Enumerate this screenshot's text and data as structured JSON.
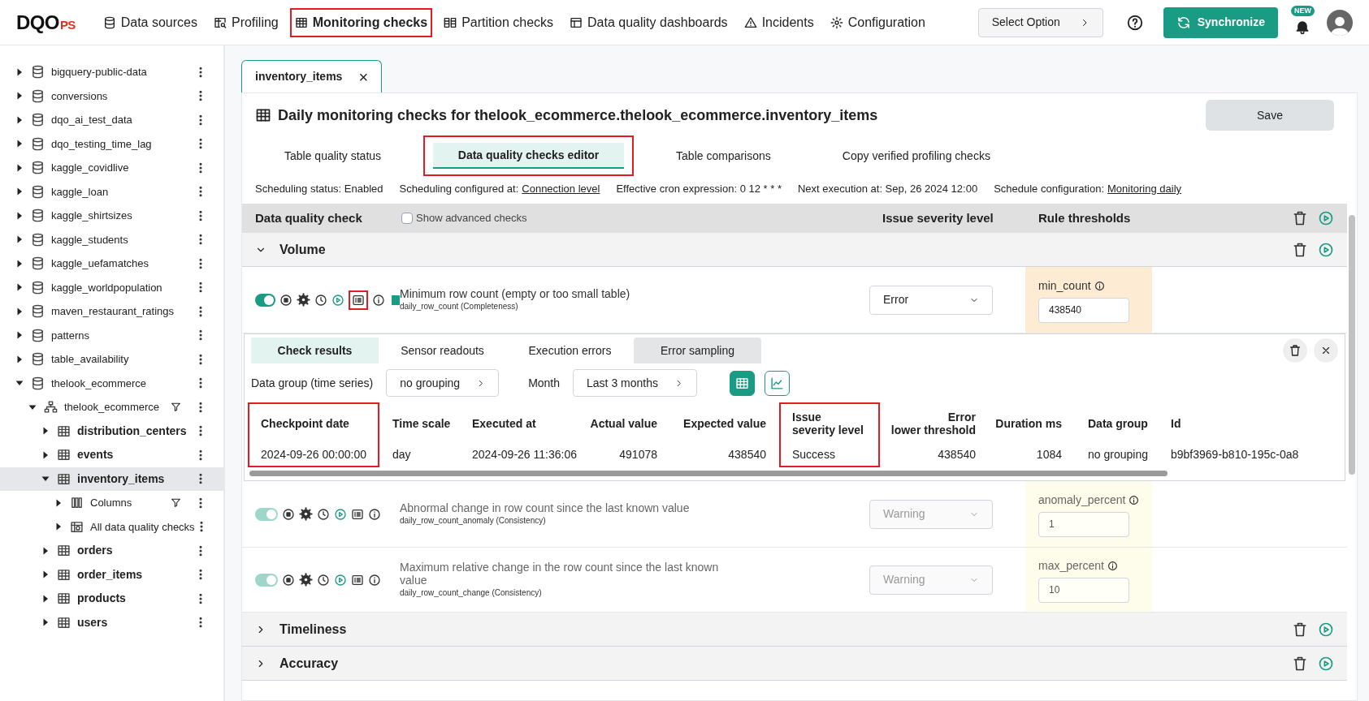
{
  "header": {
    "logo": {
      "main": "DQO",
      "suffix": "PS"
    },
    "nav": [
      {
        "kind": "database",
        "label": "Data sources",
        "selected": false,
        "highlighted": false
      },
      {
        "kind": "profiling",
        "label": "Profiling",
        "selected": false,
        "highlighted": false
      },
      {
        "kind": "table",
        "label": "Monitoring checks",
        "selected": true,
        "highlighted": true
      },
      {
        "kind": "partition",
        "label": "Partition checks",
        "selected": false,
        "highlighted": false
      },
      {
        "kind": "dashboard",
        "label": "Data quality dashboards",
        "selected": false,
        "highlighted": false
      },
      {
        "kind": "warning",
        "label": "Incidents",
        "selected": false,
        "highlighted": false
      },
      {
        "kind": "gear",
        "label": "Configuration",
        "selected": false,
        "highlighted": false
      }
    ],
    "select_option": "Select Option",
    "sync_button": "Synchronize",
    "new_badge": "NEW"
  },
  "sidebar": {
    "tree": [
      {
        "kind": "database",
        "label": "bigquery-public-data",
        "expanded": false,
        "selected": false
      },
      {
        "kind": "database",
        "label": "conversions",
        "expanded": false,
        "selected": false
      },
      {
        "kind": "database",
        "label": "dqo_ai_test_data",
        "expanded": false,
        "selected": false
      },
      {
        "kind": "database",
        "label": "dqo_testing_time_lag",
        "expanded": false,
        "selected": false
      },
      {
        "kind": "database",
        "label": "kaggle_covidlive",
        "expanded": false,
        "selected": false
      },
      {
        "kind": "database",
        "label": "kaggle_loan",
        "expanded": false,
        "selected": false
      },
      {
        "kind": "database",
        "label": "kaggle_shirtsizes",
        "expanded": false,
        "selected": false
      },
      {
        "kind": "database",
        "label": "kaggle_students",
        "expanded": false,
        "selected": false
      },
      {
        "kind": "database",
        "label": "kaggle_uefamatches",
        "expanded": false,
        "selected": false
      },
      {
        "kind": "database",
        "label": "kaggle_worldpopulation",
        "expanded": false,
        "selected": false
      },
      {
        "kind": "database",
        "label": "maven_restaurant_ratings",
        "expanded": false,
        "selected": false
      },
      {
        "kind": "database",
        "label": "patterns",
        "expanded": false,
        "selected": false
      },
      {
        "kind": "database",
        "label": "table_availability",
        "expanded": false,
        "selected": false
      },
      {
        "kind": "database",
        "label": "thelook_ecommerce",
        "expanded": true,
        "selected": false,
        "children": [
          {
            "kind": "schema",
            "label": "thelook_ecommerce",
            "expanded": true,
            "selected": false,
            "filter": true,
            "children": [
              {
                "kind": "table",
                "label": "distribution_centers",
                "expanded": false,
                "selected": false
              },
              {
                "kind": "table",
                "label": "events",
                "expanded": false,
                "selected": false
              },
              {
                "kind": "table",
                "label": "inventory_items",
                "expanded": true,
                "selected": true,
                "children": [
                  {
                    "kind": "columns",
                    "label": "Columns",
                    "expanded": false,
                    "selected": false,
                    "filter": true
                  },
                  {
                    "kind": "checks",
                    "label": "All data quality checks",
                    "expanded": false,
                    "selected": false
                  }
                ]
              },
              {
                "kind": "table",
                "label": "orders",
                "expanded": false,
                "selected": false
              },
              {
                "kind": "table",
                "label": "order_items",
                "expanded": false,
                "selected": false
              },
              {
                "kind": "table",
                "label": "products",
                "expanded": false,
                "selected": false
              },
              {
                "kind": "table",
                "label": "users",
                "expanded": false,
                "selected": false
              }
            ]
          }
        ]
      }
    ]
  },
  "editor_tab": {
    "label": "inventory_items",
    "close": "×"
  },
  "panel": {
    "title": "Daily monitoring checks for thelook_ecommerce.thelook_ecommerce.inventory_items",
    "save_button": "Save",
    "tabs": [
      {
        "label": "Table quality status",
        "selected": false,
        "highlighted": false
      },
      {
        "label": "Data quality checks editor",
        "selected": true,
        "highlighted": true
      },
      {
        "label": "Table comparisons",
        "selected": false,
        "highlighted": false
      },
      {
        "label": "Copy verified profiling checks",
        "selected": false,
        "highlighted": false
      }
    ],
    "schedule": [
      {
        "label": "Scheduling status: Enabled"
      },
      {
        "label": "Scheduling configured at:",
        "link": "Connection level"
      },
      {
        "label": "Effective cron expression: 0 12 * * *"
      },
      {
        "label": "Next execution at: Sep, 26 2024 12:00"
      },
      {
        "label": "Schedule configuration:",
        "link": "Monitoring daily"
      }
    ],
    "columns": {
      "check": "Data quality check",
      "advanced": "Show advanced checks",
      "advanced_checked": false,
      "severity": "Issue severity level",
      "thresholds": "Rule thresholds"
    },
    "categories": [
      {
        "name": "Volume",
        "expanded": true,
        "checks": [
          {
            "toggle_on": true,
            "configured": true,
            "results_open": true,
            "highlighted_results_icon": true,
            "title": "Minimum row count (empty or too small table)",
            "subtitle": "daily_row_count (Completeness)",
            "severity": "Error",
            "param": "min_count",
            "value": "438540"
          },
          {
            "toggle_on": true,
            "configured": false,
            "results_open": false,
            "highlighted_results_icon": false,
            "title": "Abnormal change in row count since the last known value",
            "subtitle": "daily_row_count_anomaly (Consistency)",
            "severity": "Warning",
            "param": "anomaly_percent",
            "value": "1"
          },
          {
            "toggle_on": true,
            "configured": false,
            "results_open": false,
            "highlighted_results_icon": false,
            "title": "Maximum relative change in the row count since the last known value",
            "subtitle": "daily_row_count_change (Consistency)",
            "severity": "Warning",
            "param": "max_percent",
            "value": "10"
          }
        ]
      },
      {
        "name": "Timeliness",
        "expanded": false
      },
      {
        "name": "Accuracy",
        "expanded": false
      }
    ]
  },
  "results": {
    "tabs": [
      {
        "label": "Check results",
        "selected": true,
        "hovered": false
      },
      {
        "label": "Sensor readouts",
        "selected": false,
        "hovered": false
      },
      {
        "label": "Execution errors",
        "selected": false,
        "hovered": false
      },
      {
        "label": "Error sampling",
        "selected": false,
        "hovered": true
      }
    ],
    "data_group_label": "Data group (time series)",
    "data_group": "no grouping",
    "month_label": "Month",
    "month": "Last 3 months",
    "views": [
      {
        "kind": "table",
        "selected": true
      },
      {
        "kind": "chart",
        "selected": false
      }
    ],
    "columns": [
      {
        "header": "Checkpoint date",
        "highlighted": true
      },
      {
        "header": "Time scale",
        "highlighted": false
      },
      {
        "header": "Executed at",
        "highlighted": false
      },
      {
        "header": "Actual value",
        "highlighted": false
      },
      {
        "header": "Expected value",
        "highlighted": false
      },
      {
        "header": "Issue\nseverity level",
        "highlighted": true
      },
      {
        "header": "Error\nlower threshold",
        "highlighted": false
      },
      {
        "header": "Duration ms",
        "highlighted": false
      },
      {
        "header": "Data group",
        "highlighted": false
      },
      {
        "header": "Id",
        "highlighted": false
      }
    ],
    "rows": [
      [
        "2024-09-26 00:00:00",
        "day",
        "2024-09-26 11:36:06",
        "491078",
        "438540",
        "Success",
        "438540",
        "1084",
        "no grouping",
        "b9bf3969-b810-195c-0a8"
      ]
    ]
  }
}
